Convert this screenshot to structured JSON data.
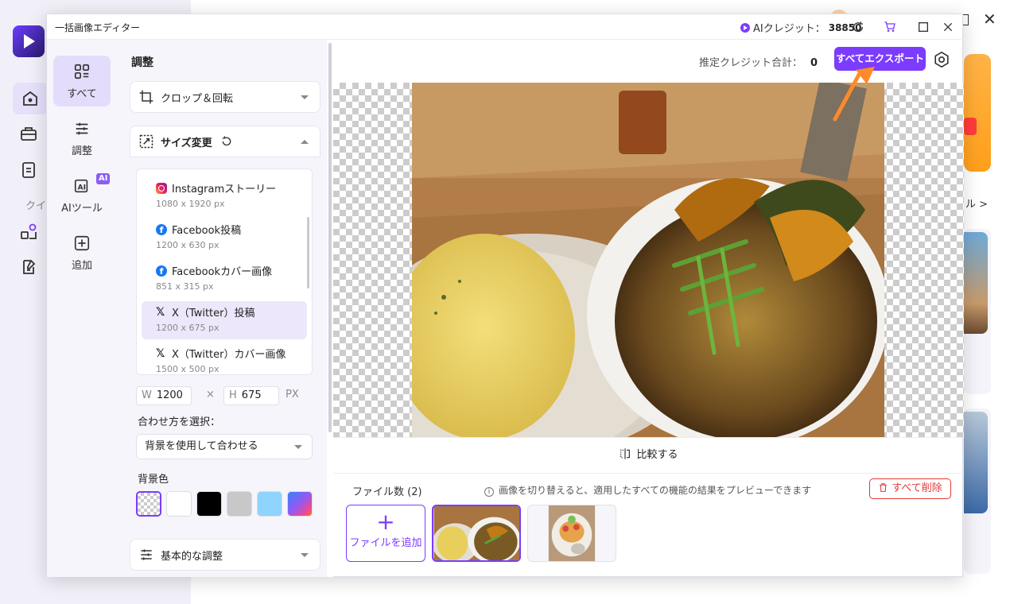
{
  "background_app": {
    "quick_label": "クイ",
    "tool_link": "ル >"
  },
  "dialog": {
    "title": "一括画像エディター",
    "credit_label": "AIクレジット：",
    "credit_value": "38850"
  },
  "nav": {
    "items": [
      {
        "label": "すべて",
        "icon": "grid-icon",
        "active": true
      },
      {
        "label": "調整",
        "icon": "sliders-icon"
      },
      {
        "label": "AIツール",
        "icon": "ai-icon",
        "badge": "AI"
      },
      {
        "label": "追加",
        "icon": "add-square-icon"
      }
    ]
  },
  "settings": {
    "title": "調整",
    "crop_label": "クロップ＆回転",
    "resize_label": "サイズ変更",
    "basic_adjust_label": "基本的な調整",
    "presets": [
      {
        "name": "Instagramストーリー",
        "dims": "1080 x 1920 px",
        "icon": "instagram-icon"
      },
      {
        "name": "Facebook投稿",
        "dims": "1200 x 630 px",
        "icon": "facebook-icon"
      },
      {
        "name": "Facebookカバー画像",
        "dims": "851 x 315 px",
        "icon": "facebook-icon"
      },
      {
        "name": "X（Twitter）投稿",
        "dims": "1200 x 675 px",
        "icon": "x-icon",
        "selected": true
      },
      {
        "name": "X（Twitter）カバー画像",
        "dims": "1500 x 500 px",
        "icon": "x-icon"
      }
    ],
    "width_label": "W",
    "width_value": "1200",
    "times": "×",
    "height_label": "H",
    "height_value": "675",
    "unit": "PX",
    "fit_label": "合わせ方を選択：",
    "fit_value": "背景を使用して合わせる",
    "bg_color_label": "背景色",
    "bg_colors": [
      "transparent",
      "#ffffff",
      "#000000",
      "#c8c8c8",
      "#8fd3ff",
      "gradient"
    ]
  },
  "preview": {
    "credit_sum_label": "推定クレジット合計：",
    "credit_sum_value": "0",
    "export_label": "すべてエクスポート",
    "compare_label": "比較する"
  },
  "files": {
    "count_label": "ファイル数 (2)",
    "info": "画像を切り替えると、適用したすべての機能の結果をプレビューできます",
    "delete_all_label": "すべて削除",
    "add_label": "ファイルを追加"
  },
  "colors": {
    "accent": "#7b3cff",
    "danger": "#e53935",
    "arrow": "#ff8a2a"
  }
}
